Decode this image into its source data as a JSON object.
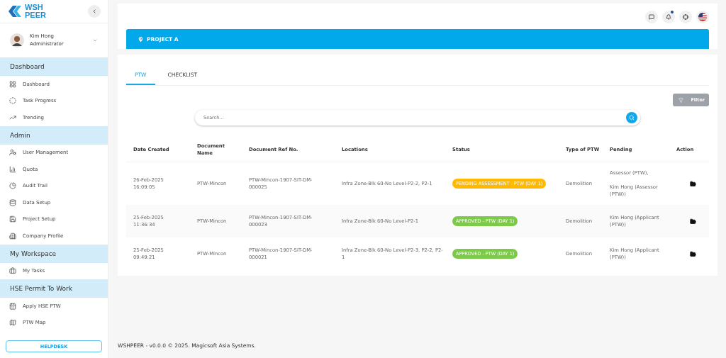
{
  "brand": {
    "line1": "WSH",
    "line2": "PEER"
  },
  "user": {
    "name": "Kim Hong",
    "role": "Administrator"
  },
  "sidebar": {
    "items": [
      {
        "kind": "section",
        "label": "Dashboard"
      },
      {
        "kind": "link",
        "label": "Dashboard"
      },
      {
        "kind": "link",
        "label": "Task Progress"
      },
      {
        "kind": "link",
        "label": "Trending"
      },
      {
        "kind": "section",
        "label": "Admin"
      },
      {
        "kind": "link",
        "label": "User Management"
      },
      {
        "kind": "link",
        "label": "Quota"
      },
      {
        "kind": "link",
        "label": "Audit Trail"
      },
      {
        "kind": "link",
        "label": "Data Setup"
      },
      {
        "kind": "link",
        "label": "Project Setup"
      },
      {
        "kind": "link",
        "label": "Company Profile"
      },
      {
        "kind": "section",
        "label": "My Workspace"
      },
      {
        "kind": "link",
        "label": "My Tasks"
      },
      {
        "kind": "section",
        "label": "HSE Permit To Work"
      },
      {
        "kind": "link",
        "label": "Apply HSE PTW"
      },
      {
        "kind": "link",
        "label": "PTW Map"
      }
    ],
    "helpdesk": "HELPDESK"
  },
  "project": "PROJECT A",
  "tabs": [
    {
      "label": "PTW",
      "selected": true
    },
    {
      "label": "CHECKLIST",
      "selected": false
    }
  ],
  "filter": "Filter",
  "search": {
    "placeholder": "Search..."
  },
  "table": {
    "columns": [
      "Date Created",
      "Document Name",
      "Document Ref No.",
      "Locations",
      "Status",
      "Type of PTW",
      "Pending",
      "Action"
    ],
    "rows": [
      {
        "date": "26-Feb-2025 16:09:05",
        "name": "PTW-Mincon",
        "ref": "PTW-Mincon-1907-SIT-DM-000025",
        "location": "Infra Zone-Blk 60-No Level-P2-2, P2-1",
        "status": "PENDING ASSESSMENT - PTW (DAY 1)",
        "color": "#ffb900",
        "type": "Demolition",
        "pending": [
          "Assessor (PTW),",
          "Kim Hong (Assessor (PTW))"
        ]
      },
      {
        "date": "25-Feb-2025 11:36:34",
        "name": "PTW-Mincon",
        "ref": "PTW-Mincon-1907-SIT-DM-000023",
        "location": "Infra Zone-Blk 60-No Level-P2-1",
        "status": "APPROVED - PTW (DAY 1)",
        "color": "#7dc94a",
        "type": "Demolition",
        "pending": [
          "Kim Hong (Applicant (PTW))"
        ]
      },
      {
        "date": "25-Feb-2025 09:49:21",
        "name": "PTW-Mincon",
        "ref": "PTW-Mincon-1907-SIT-DM-000021",
        "location": "Infra Zone-Blk 60-No Level-P2-3, P2-2, P2-1",
        "status": "APPROVED - PTW (DAY 1)",
        "color": "#7dc94a",
        "type": "Demolition",
        "pending": [
          "Kim Hong (Applicant (PTW))"
        ]
      }
    ]
  },
  "footer": "WSHPEER - v0.0.0 © 2025. Magicsoft Asia Systems."
}
